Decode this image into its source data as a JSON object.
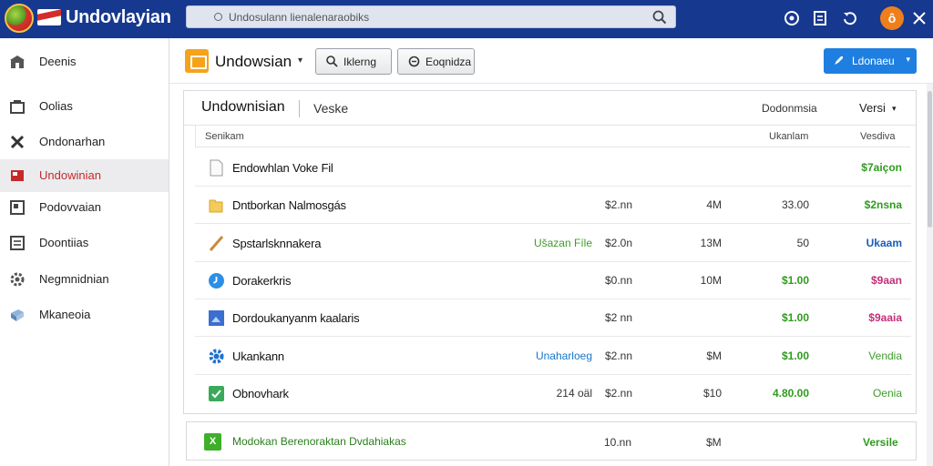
{
  "app": {
    "title": "Undovlayian",
    "avatar_letter": "ô"
  },
  "search": {
    "text": "Undosulann lienalenaraobiks"
  },
  "colors": {
    "topbar": "#17388f",
    "accent": "#1f7fe0",
    "active_item": "#c62a2a",
    "positive": "#2f9b1e"
  },
  "sidebar": {
    "items": [
      {
        "label": "Deenis",
        "icon": "store-icon",
        "active": false
      },
      {
        "label": "Oolias",
        "icon": "register-icon",
        "active": false
      },
      {
        "label": "Ondonarhan",
        "icon": "tools-icon",
        "active": false
      },
      {
        "label": "Undowinian",
        "icon": "flag-icon",
        "active": true
      },
      {
        "label": "Podovvaian",
        "icon": "document-icon",
        "active": false
      },
      {
        "label": "Doontiias",
        "icon": "list-icon",
        "active": false
      },
      {
        "label": "Negmnidnian",
        "icon": "gear-icon",
        "active": false
      },
      {
        "label": "Mkaneoia",
        "icon": "cube-icon",
        "active": false
      }
    ]
  },
  "toolbar": {
    "title": "Undowsian",
    "search_button": "Iklerng",
    "second_button": "Eoqnidza",
    "primary_button": "Ldonaeu"
  },
  "panel": {
    "title": "Undownisian",
    "tab": "Veske",
    "right_label": "Dodonmsia",
    "sort_label": "Versi"
  },
  "columns": {
    "name": "Senikam",
    "col_a": "Ukanlam",
    "col_b": "Vesdiva"
  },
  "rows": [
    {
      "icon": "file-icon",
      "name": "Endowhlan Voke Fil",
      "tag": "",
      "price": "",
      "size": "",
      "amount": "",
      "status": "$7aiçon",
      "status_tone": "green"
    },
    {
      "icon": "folder-icon",
      "name": "Dntborkan Nalmosgás",
      "tag": "",
      "price": "$2.nn",
      "size": "4M",
      "amount": "33.00",
      "status": "$2nsna",
      "status_tone": "green"
    },
    {
      "icon": "pencil-icon",
      "name": "Spstarlsknnakera",
      "tag": "Ušazan Fíle",
      "price": "$2.0n",
      "size": "13M",
      "amount": "50",
      "status": "Ukaam",
      "status_tone": "blue"
    },
    {
      "icon": "clock-icon",
      "name": "Dorakerkris",
      "tag": "",
      "price": "$0.nn",
      "size": "10M",
      "amount": "$1.00",
      "status": "$9aan",
      "status_tone": "pink"
    },
    {
      "icon": "image-icon",
      "name": "Dordoukanyanm kaalaris",
      "tag": "",
      "price": "$2 nn",
      "size": "",
      "amount": "$1.00",
      "status": "$9aaia",
      "status_tone": "pink"
    },
    {
      "icon": "gear-icon",
      "name": "Ukankann",
      "tag": "Unaharloeg",
      "price": "$2.nn",
      "size": "$M",
      "amount": "$1.00",
      "status": "Vendia",
      "status_tone": "green"
    },
    {
      "icon": "check-icon",
      "name": "Obnovhark",
      "tag": "214 oäl",
      "price": "$2.nn",
      "size": "$10",
      "amount": "4.80.00",
      "status": "Oenia",
      "status_tone": "greenlt"
    }
  ],
  "footer_row": {
    "icon": "sheet-icon",
    "name": "Modokan Berenoraktan Dvdahiakas",
    "price": "10.nn",
    "size": "$M",
    "status": "Versile"
  }
}
